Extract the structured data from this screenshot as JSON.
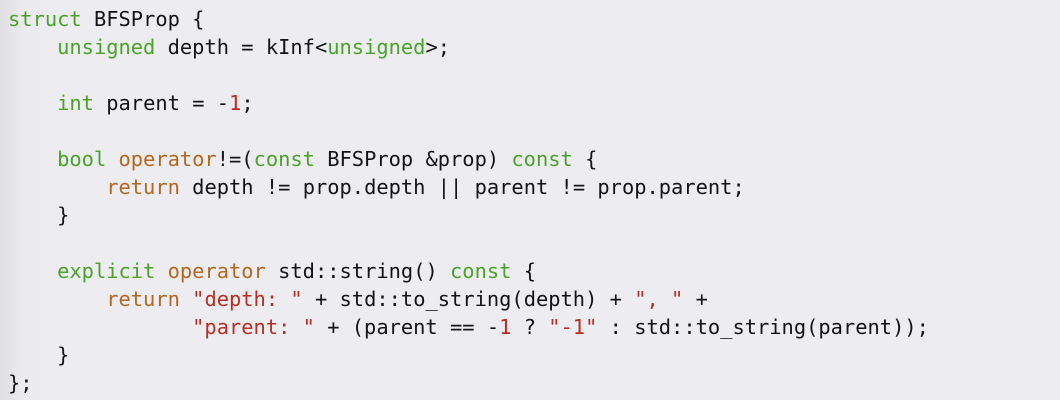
{
  "colors": {
    "background": "#ececf1",
    "text": "#141414",
    "keyword": "#4aa329",
    "keyword_alt": "#b2691e",
    "literal": "#b72f22"
  },
  "code": {
    "lines": [
      {
        "text": "struct BFSProp {"
      },
      {
        "text": "    unsigned depth = kInf<unsigned>;"
      },
      {
        "text": ""
      },
      {
        "text": "    int parent = -1;"
      },
      {
        "text": ""
      },
      {
        "text": "    bool operator!=(const BFSProp &prop) const {"
      },
      {
        "text": "        return depth != prop.depth || parent != prop.parent;"
      },
      {
        "text": "    }"
      },
      {
        "text": ""
      },
      {
        "text": "    explicit operator std::string() const {"
      },
      {
        "text": "        return \"depth: \" + std::to_string(depth) + \", \" +"
      },
      {
        "text": "               \"parent: \" + (parent == -1 ? \"-1\" : std::to_string(parent));"
      },
      {
        "text": "    }"
      },
      {
        "text": "};"
      }
    ]
  }
}
